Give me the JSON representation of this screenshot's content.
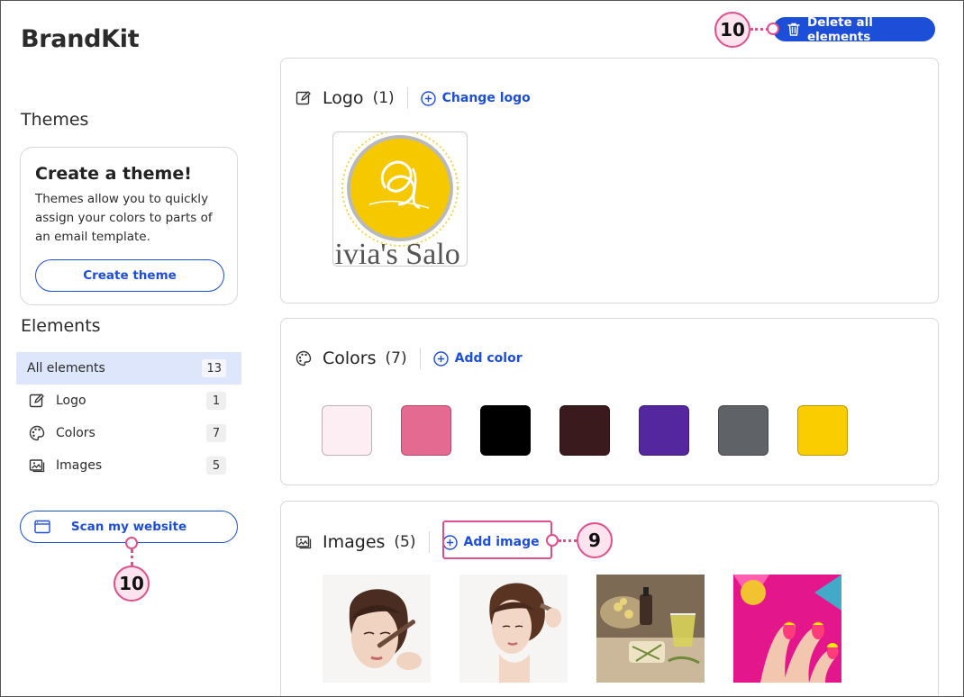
{
  "app": {
    "title": "BrandKit"
  },
  "header": {
    "delete_all_label": "Delete all elements"
  },
  "sidebar": {
    "themes_heading": "Themes",
    "theme_card": {
      "title": "Create a theme!",
      "description": "Themes allow you to quickly assign your colors to parts of an email template.",
      "button_label": "Create theme"
    },
    "elements_heading": "Elements",
    "items": [
      {
        "label": "All elements",
        "count": "13",
        "active": true,
        "icon": "none"
      },
      {
        "label": "Logo",
        "count": "1",
        "active": false,
        "icon": "edit-icon"
      },
      {
        "label": "Colors",
        "count": "7",
        "active": false,
        "icon": "palette-icon"
      },
      {
        "label": "Images",
        "count": "5",
        "active": false,
        "icon": "image-icon"
      }
    ],
    "scan_button_label": "Scan my website"
  },
  "callouts": {
    "delete_all": "10",
    "scan_website": "10",
    "add_image": "9"
  },
  "panels": {
    "logo": {
      "title": "Logo",
      "count": "(1)",
      "action_label": "Change logo",
      "logo_text": "livia's Salo"
    },
    "colors": {
      "title": "Colors",
      "count": "(7)",
      "action_label": "Add color",
      "swatches": [
        "#fdeef3",
        "#e46a92",
        "#000000",
        "#3a1a1c",
        "#55279e",
        "#5f6266",
        "#f9cd00"
      ]
    },
    "images": {
      "title": "Images",
      "count": "(5)",
      "action_label": "Add image"
    }
  },
  "colors": {
    "accent": "#1d4ed8",
    "callout": "#e0508c",
    "active_nav": "#dde6fb"
  }
}
